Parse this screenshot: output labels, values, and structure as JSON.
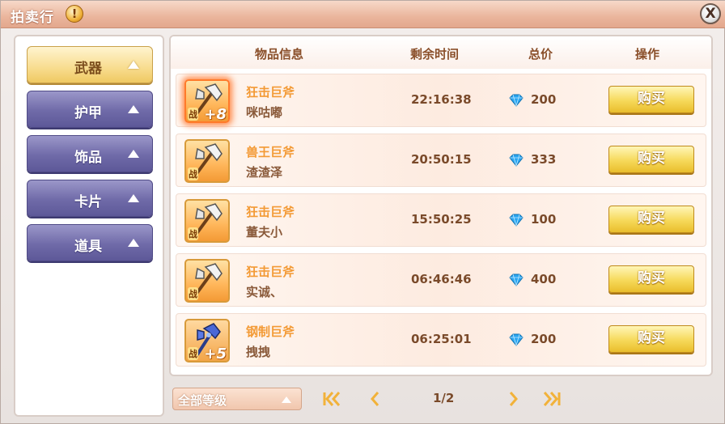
{
  "window": {
    "title": "拍卖行",
    "help_icon": "!",
    "close_icon": "X"
  },
  "categories": [
    {
      "label": "武器",
      "active": true
    },
    {
      "label": "护甲",
      "active": false
    },
    {
      "label": "饰品",
      "active": false
    },
    {
      "label": "卡片",
      "active": false
    },
    {
      "label": "道具",
      "active": false
    }
  ],
  "table": {
    "headers": [
      "物品信息",
      "剩余时间",
      "总价",
      "操作"
    ],
    "rows": [
      {
        "name": "狂击巨斧",
        "seller": "咪咕嘟",
        "time": "22:16:38",
        "price": "200",
        "buy": "购买",
        "tag": "战",
        "plus": "+8",
        "icon": "axe-icon"
      },
      {
        "name": "兽王巨斧",
        "seller": "渣渣泽",
        "time": "20:50:15",
        "price": "333",
        "buy": "购买",
        "tag": "战",
        "plus": "",
        "icon": "axe-icon"
      },
      {
        "name": "狂击巨斧",
        "seller": "董夫小",
        "time": "15:50:25",
        "price": "100",
        "buy": "购买",
        "tag": "战",
        "plus": "",
        "icon": "axe-icon"
      },
      {
        "name": "狂击巨斧",
        "seller": "实诚、",
        "time": "06:46:46",
        "price": "400",
        "buy": "购买",
        "tag": "战",
        "plus": "",
        "icon": "axe-icon"
      },
      {
        "name": "钢制巨斧",
        "seller": "拽拽",
        "time": "06:25:01",
        "price": "200",
        "buy": "购买",
        "tag": "战",
        "plus": "+5",
        "icon": "steel-axe-icon"
      }
    ]
  },
  "footer": {
    "level_filter": "全部等级",
    "page": "1/2"
  },
  "colors": {
    "active_tab": "#f8dc8e",
    "tab": "#6f6aa8",
    "buy_button": "#f6d95a",
    "item_name": "#f39a35"
  }
}
